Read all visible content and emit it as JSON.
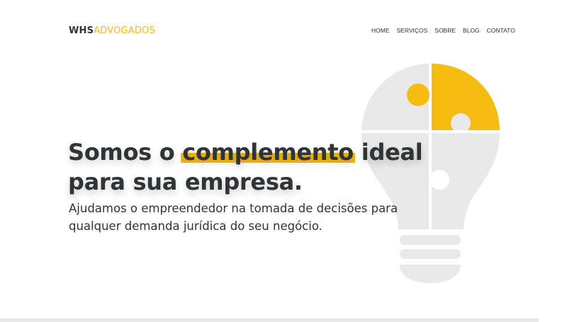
{
  "brand": {
    "part1": "WHS",
    "part2": "ADVOGADOS"
  },
  "nav": {
    "items": [
      {
        "label": "HOME",
        "active": true
      },
      {
        "label": "SERVIÇOS",
        "active": false
      },
      {
        "label": "SOBRE",
        "active": false
      },
      {
        "label": "BLOG",
        "active": false
      },
      {
        "label": "CONTATO",
        "active": false
      }
    ]
  },
  "hero": {
    "title_before": "Somos o ",
    "title_highlight": "complemento",
    "title_after": " ideal para sua empresa.",
    "subtitle": "Ajudamos o empreendedor na tomada de decisões para qualquer demanda jurídica do seu negócio."
  },
  "colors": {
    "accent": "#f5bd12",
    "text": "#2f3437",
    "bulb": "#e9e9e9"
  },
  "illustration": {
    "icon": "puzzle-lightbulb-icon"
  }
}
